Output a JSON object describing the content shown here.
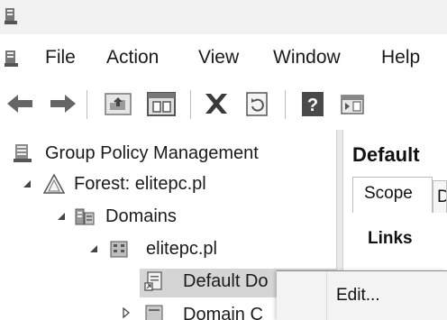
{
  "window": {
    "icon": "gpmc-app-icon"
  },
  "menubar": {
    "icon": "gpmc-app-icon",
    "items": [
      "File",
      "Action",
      "View",
      "Window",
      "Help"
    ]
  },
  "toolbar": {
    "buttons": [
      "back-arrow-icon",
      "forward-arrow-icon",
      "up-folder-icon",
      "show-hide-console-tree-icon",
      "delete-icon",
      "refresh-icon",
      "help-icon",
      "show-action-pane-icon"
    ]
  },
  "tree": {
    "root": "Group Policy Management",
    "forest": "Forest: elitepc.pl",
    "domains": "Domains",
    "domain": "elitepc.pl",
    "selected_item": "Default Do",
    "next_item": "Domain C"
  },
  "details": {
    "title": "Default",
    "tabs": [
      "Scope",
      "D"
    ],
    "section": "Links"
  },
  "context_menu": {
    "items": [
      "Edit..."
    ]
  }
}
